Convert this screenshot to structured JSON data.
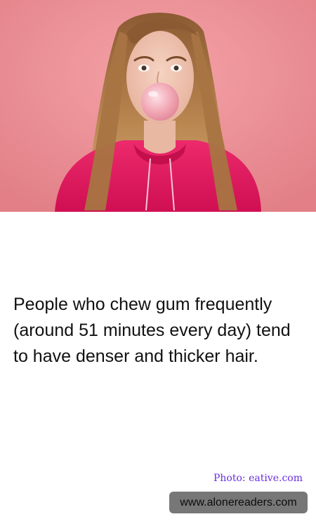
{
  "image": {
    "subject": "woman-blowing-bubble-gum",
    "background_color": "#ee8f95",
    "hoodie_color": "#e3175e",
    "bubble_color": "#f2a9b6"
  },
  "fact": {
    "text": "People who chew gum frequently (around 51 minutes every day) tend to have denser and thicker hair."
  },
  "credit": {
    "text": "Photo: eative.com",
    "color": "#6a2ee0"
  },
  "site": {
    "label": "www.alonereaders.com"
  }
}
